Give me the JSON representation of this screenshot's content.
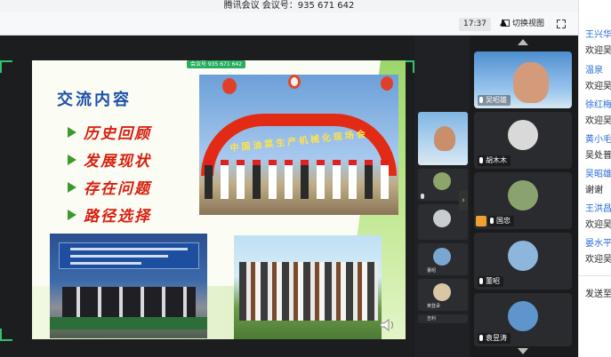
{
  "window": {
    "title": "腾讯会议 会议号：935 671 642"
  },
  "toolbar": {
    "time": "17:37",
    "switch_view": "切换视图"
  },
  "share": {
    "badge": "会议号 935 671 642"
  },
  "slide": {
    "title": "交流内容",
    "bullets": [
      "历史回顾",
      "发展现状",
      "存在问题",
      "路径选择"
    ],
    "banner": "中国油菜生产机械化现场会"
  },
  "thumbnails": [
    {
      "name": "吴昭雄"
    },
    {
      "name": ""
    },
    {
      "name": ""
    },
    {
      "name": "董昭"
    },
    {
      "name": "黄登承"
    },
    {
      "name": "吉利"
    }
  ],
  "gallery": [
    {
      "name": "吴昭雄"
    },
    {
      "name": "胡木木"
    },
    {
      "name": "国忠"
    },
    {
      "name": "董昭"
    },
    {
      "name": "袁昱涛"
    }
  ],
  "chat": {
    "messages": [
      {
        "name": "王兴华",
        "body": "欢迎吴"
      },
      {
        "name": "温泉",
        "body": "欢迎吴"
      },
      {
        "name": "徐红梅",
        "body": "欢迎吴"
      },
      {
        "name": "黄小毛",
        "body": "吴处普"
      },
      {
        "name": "吴昭雄",
        "body": "谢谢"
      },
      {
        "name": "王洪昌",
        "body": "欢迎吴"
      },
      {
        "name": "晏水平",
        "body": "欢迎吴"
      }
    ],
    "send_label": "发送至"
  },
  "colors": {
    "accent_green": "#2ec46d",
    "slide_title": "#1d4fa8",
    "slide_bullets": "#d7200f",
    "chat_name": "#2a6bd6"
  }
}
